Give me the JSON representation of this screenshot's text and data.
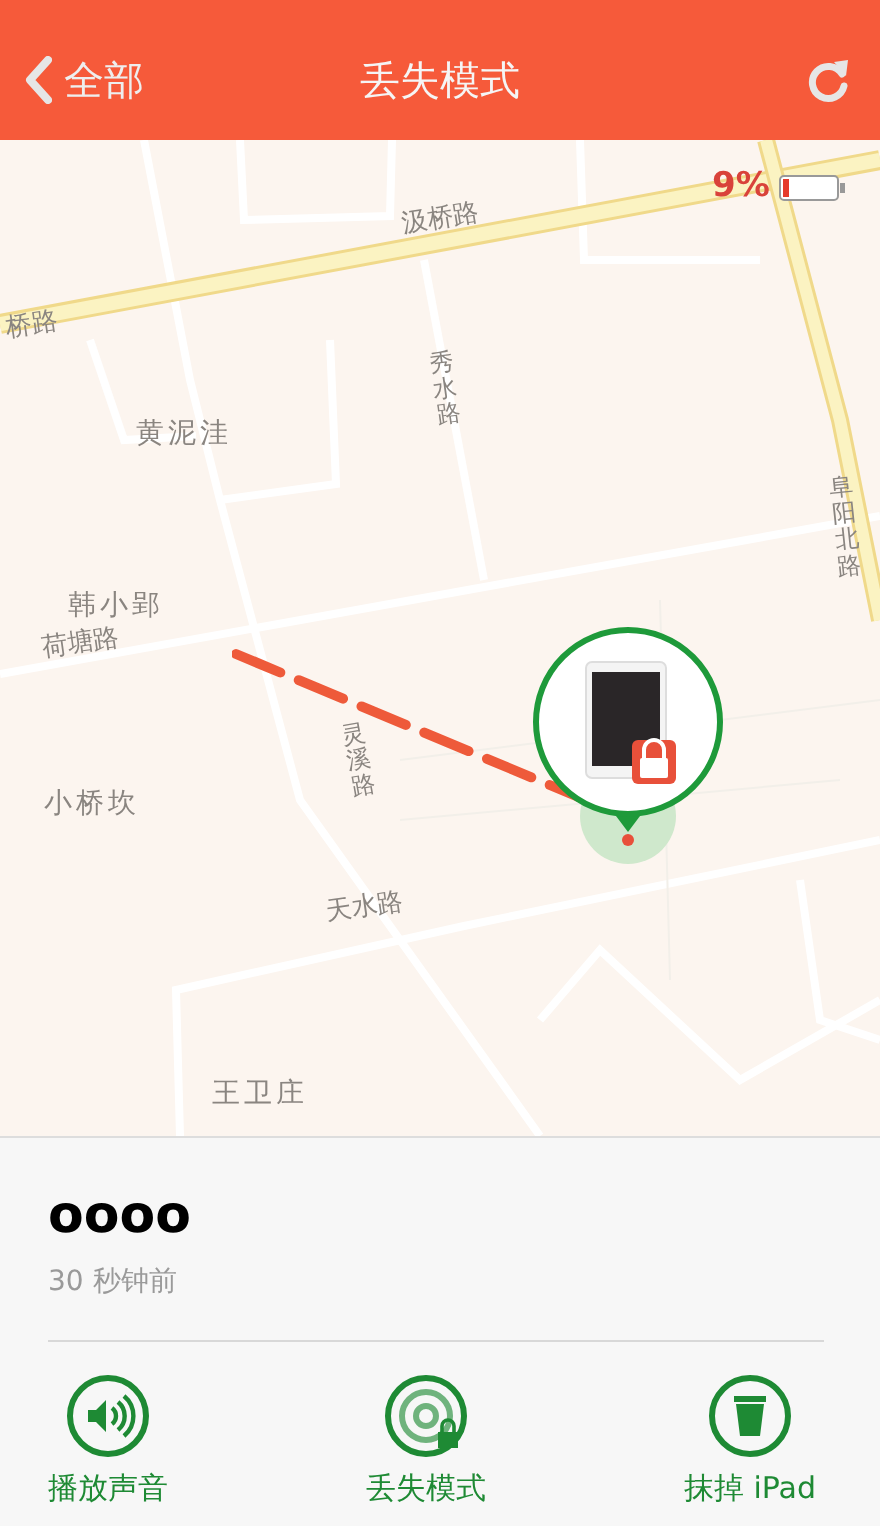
{
  "nav_bar": {
    "back_label": "全部",
    "title": "丢失模式"
  },
  "map": {
    "battery_reading": "9%",
    "labels": [
      {
        "text": "汲桥路",
        "kind": "road"
      },
      {
        "text": "桥路",
        "kind": "road"
      },
      {
        "text": "黄泥洼",
        "kind": "place"
      },
      {
        "text": "秀水路",
        "kind": "vertical"
      },
      {
        "text": "韩小郢",
        "kind": "place"
      },
      {
        "text": "荷塘路",
        "kind": "road"
      },
      {
        "text": "灵溪路",
        "kind": "vertical"
      },
      {
        "text": "小桥坎",
        "kind": "place"
      },
      {
        "text": "天水路",
        "kind": "road"
      },
      {
        "text": "王卫庄",
        "kind": "place"
      },
      {
        "text": "阜阳北路",
        "kind": "vertical"
      }
    ]
  },
  "device": {
    "name": "oooo",
    "last_seen": "30 秒钟前"
  },
  "actions": [
    {
      "label": "播放声音",
      "kind": "sound"
    },
    {
      "label": "丢失模式",
      "kind": "lost"
    },
    {
      "label": "抹掉 iPad",
      "kind": "erase"
    }
  ]
}
